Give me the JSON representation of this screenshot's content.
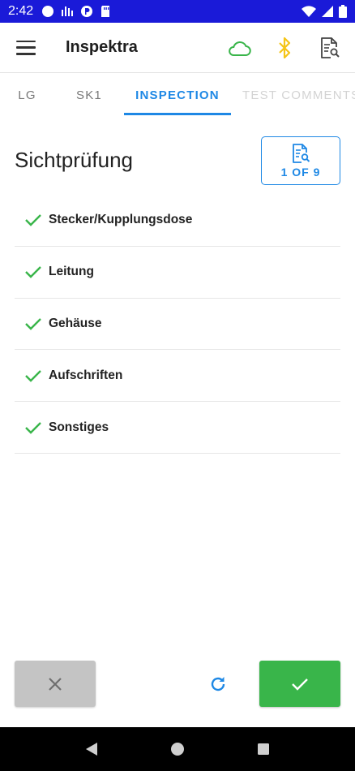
{
  "status_bar": {
    "time": "2:42",
    "bg_color": "#1a1ad8"
  },
  "app_bar": {
    "title": "Inspektra",
    "icons": [
      "menu-icon",
      "cloud-icon",
      "bluetooth-icon",
      "document-search-icon"
    ],
    "cloud_color": "#39b54a",
    "bluetooth_color": "#f5c518"
  },
  "tabs": [
    {
      "label": "LG",
      "active": false
    },
    {
      "label": "SK1",
      "active": false
    },
    {
      "label": "INSPECTION",
      "active": true
    },
    {
      "label": "TEST COMMENTS",
      "active": false
    }
  ],
  "section": {
    "title": "Sichtprüfung",
    "page_indicator": "1 OF 9"
  },
  "checklist": [
    {
      "label": "Stecker/Kupplungsdose",
      "checked": true
    },
    {
      "label": "Leitung",
      "checked": true
    },
    {
      "label": "Gehäuse",
      "checked": true
    },
    {
      "label": "Aufschriften",
      "checked": true
    },
    {
      "label": "Sonstiges",
      "checked": true
    }
  ],
  "colors": {
    "accent": "#1e88e5",
    "check": "#39b54a",
    "confirm": "#39b54a",
    "cancel": "#c4c4c4"
  }
}
